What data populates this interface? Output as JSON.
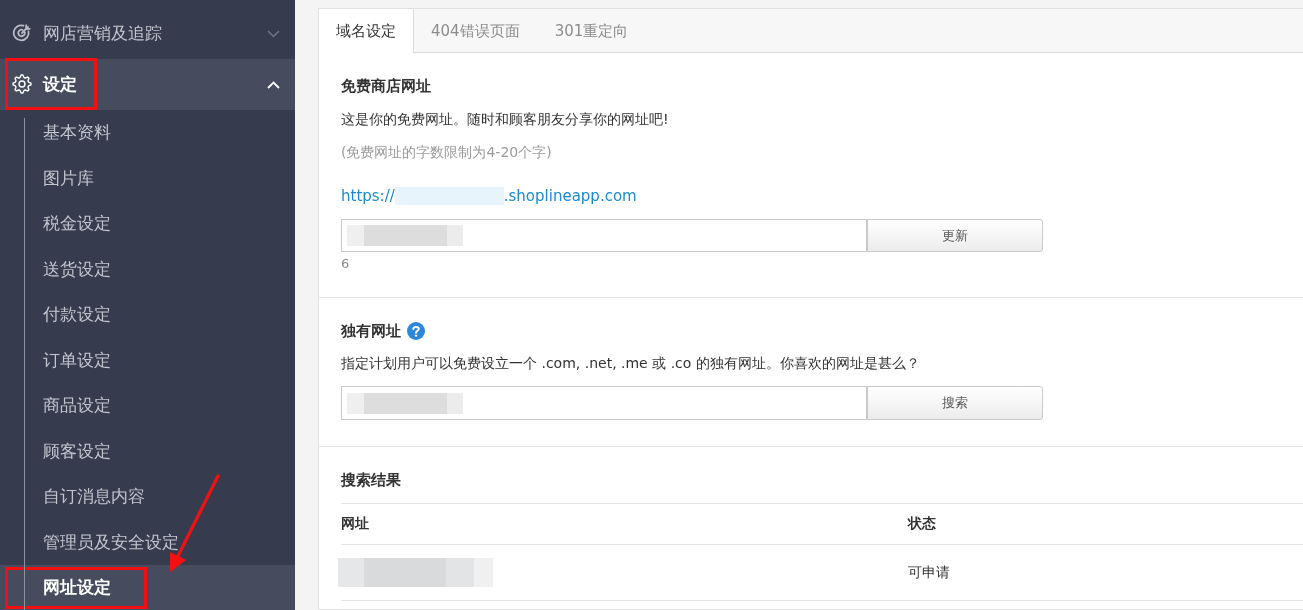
{
  "sidebar": {
    "pointer_arrow": true,
    "items": [
      {
        "label": "网店营销及追踪",
        "expanded": false,
        "highlighted": false
      },
      {
        "label": "设定",
        "expanded": true,
        "highlighted": true,
        "children": [
          {
            "label": "基本资料",
            "selected": false,
            "highlighted": false
          },
          {
            "label": "图片库",
            "selected": false,
            "highlighted": false
          },
          {
            "label": "税金设定",
            "selected": false,
            "highlighted": false
          },
          {
            "label": "送货设定",
            "selected": false,
            "highlighted": false
          },
          {
            "label": "付款设定",
            "selected": false,
            "highlighted": false
          },
          {
            "label": "订单设定",
            "selected": false,
            "highlighted": false
          },
          {
            "label": "商品设定",
            "selected": false,
            "highlighted": false
          },
          {
            "label": "顾客设定",
            "selected": false,
            "highlighted": false
          },
          {
            "label": "自订消息内容",
            "selected": false,
            "highlighted": false
          },
          {
            "label": "管理员及安全设定",
            "selected": false,
            "highlighted": false
          },
          {
            "label": "网址设定",
            "selected": true,
            "highlighted": true
          }
        ]
      }
    ]
  },
  "tabs": [
    {
      "label": "域名设定",
      "selected": true
    },
    {
      "label": "404错误页面",
      "selected": false
    },
    {
      "label": "301重定向",
      "selected": false
    }
  ],
  "free_url": {
    "title": "免费商店网址",
    "description": "这是你的免费网址。随时和顾客朋友分享你的网址吧!",
    "note": "(免费网址的字数限制为4-20个字)",
    "link": {
      "prefix": "https://",
      "redacted": true,
      "suffix": ".shoplineapp.com"
    },
    "input": {
      "redacted": true
    },
    "count": "6",
    "button": "更新"
  },
  "custom_domain": {
    "title": "独有网址",
    "description": "指定计划用户可以免费设立一个 .com, .net, .me 或 .co 的独有网址。你喜欢的网址是甚么？",
    "input": {
      "redacted": true
    },
    "button": "搜索"
  },
  "search_results": {
    "title": "搜索结果",
    "columns": [
      "网址",
      "状态"
    ],
    "rows": [
      {
        "cells": [
          {
            "redacted": true
          },
          {
            "redacted": false,
            "text": "可申请"
          }
        ]
      }
    ]
  }
}
